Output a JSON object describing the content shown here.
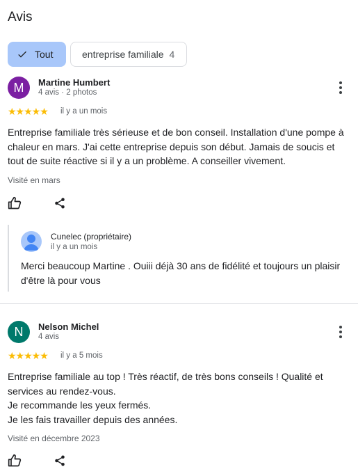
{
  "header": {
    "title": "Avis"
  },
  "filters": {
    "all_label": "Tout",
    "family_label": "entreprise familiale",
    "family_count": "4"
  },
  "reviews": [
    {
      "initial": "M",
      "avatar_color": "#7b1fa2",
      "name": "Martine Humbert",
      "meta": "4 avis · 2 photos",
      "stars": "★★★★★",
      "ago": "il y a un mois",
      "text": "Entreprise familiale très sérieuse et de bon conseil. Installation d'une pompe à chaleur en mars. J'ai cette entreprise depuis son début. Jamais de soucis et tout de suite réactive si il y a un problème. A conseiller vivement.",
      "visited": "Visité en mars",
      "reply": {
        "owner": "Cunelec (propriétaire)",
        "ago": "il y a un mois",
        "text": "Merci beaucoup Martine . Ouiii déjà 30 ans de fidélité et toujours un plaisir d'être là pour vous"
      }
    },
    {
      "initial": "N",
      "avatar_color": "#00796b",
      "name": "Nelson Michel",
      "meta": "4 avis",
      "stars": "★★★★★",
      "ago": "il y a 5 mois",
      "text": "Entreprise familiale au top ! Très réactif, de très bons conseils ! Qualité et services au rendez-vous.\nJe recommande les yeux fermés.\nJe les fais travailler depuis des années.",
      "visited": "Visité en décembre 2023"
    }
  ],
  "icons": {
    "check": "check-icon",
    "more": "more-vert-icon",
    "like": "thumb-up-icon",
    "share": "share-icon"
  },
  "colors": {
    "chip_selected": "#a8c7fa",
    "star": "#fbbc04"
  }
}
